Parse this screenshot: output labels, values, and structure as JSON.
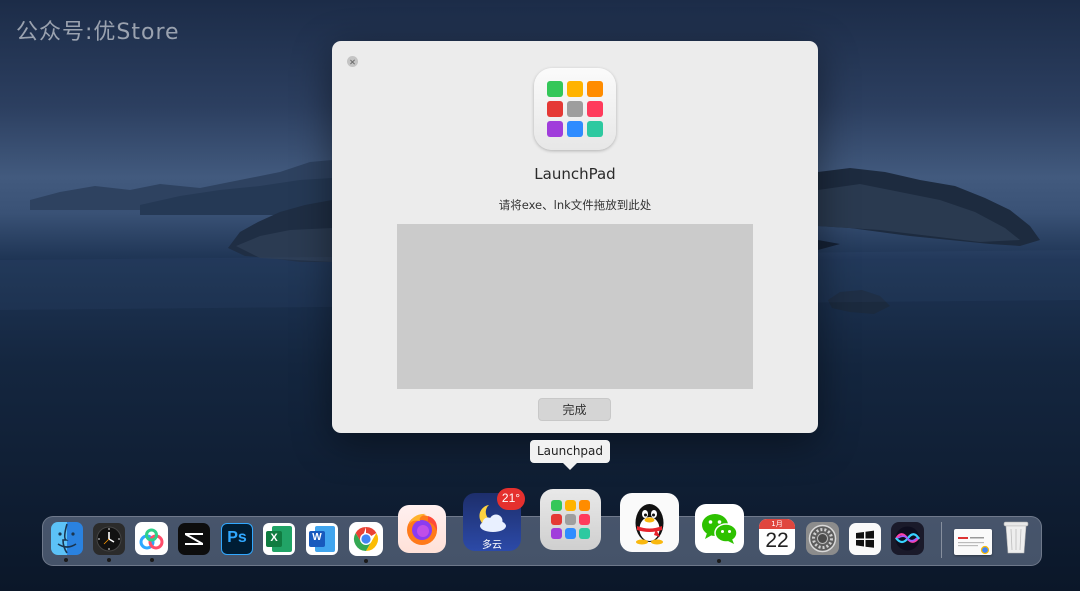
{
  "watermark": "公众号:优Store",
  "dialog": {
    "title": "LaunchPad",
    "hint": "请将exe、lnk文件拖放到此处",
    "done_label": "完成"
  },
  "tooltip": "Launchpad",
  "dock": {
    "apps": [
      {
        "name": "Finder",
        "icon": "finder-icon",
        "running": true
      },
      {
        "name": "Clock",
        "icon": "clock-icon",
        "running": true
      },
      {
        "name": "Baidu Netdisk",
        "icon": "baidu-netdisk-icon",
        "running": true
      },
      {
        "name": "CapCut",
        "icon": "capcut-icon",
        "running": false
      },
      {
        "name": "Photoshop",
        "icon": "photoshop-icon",
        "running": false,
        "label": "Ps"
      },
      {
        "name": "Excel",
        "icon": "excel-icon",
        "running": false,
        "label": "X"
      },
      {
        "name": "Word",
        "icon": "word-icon",
        "running": false,
        "label": "W"
      },
      {
        "name": "Chrome",
        "icon": "chrome-icon",
        "running": true
      },
      {
        "name": "Firefox",
        "icon": "firefox-icon",
        "running": false
      },
      {
        "name": "Weather",
        "icon": "weather-icon",
        "running": false,
        "temperature": "21°",
        "condition": "多云"
      },
      {
        "name": "Launchpad",
        "icon": "launchpad-icon",
        "running": false
      },
      {
        "name": "QQ",
        "icon": "qq-icon",
        "running": false
      },
      {
        "name": "WeChat",
        "icon": "wechat-icon",
        "running": true
      },
      {
        "name": "Calendar",
        "icon": "calendar-icon",
        "running": false,
        "month": "1月",
        "day": "22"
      },
      {
        "name": "System Preferences",
        "icon": "settings-icon",
        "running": false
      },
      {
        "name": "Windows",
        "icon": "windows-icon",
        "running": false
      },
      {
        "name": "Siri",
        "icon": "siri-icon",
        "running": false
      }
    ],
    "extras": [
      {
        "name": "Document",
        "icon": "document-icon"
      },
      {
        "name": "Trash",
        "icon": "trash-icon"
      }
    ]
  },
  "colors": {
    "launchpad_tiles": [
      "#34c759",
      "#ffb300",
      "#ff8c00",
      "#e53935",
      "#9e9e9e",
      "#ff3b5c",
      "#a03ddb",
      "#2f8cff",
      "#2ec9a0"
    ],
    "dialog_bg": "#ececec",
    "drop_zone": "#cbcbcb",
    "badge_red": "#e5302e"
  }
}
